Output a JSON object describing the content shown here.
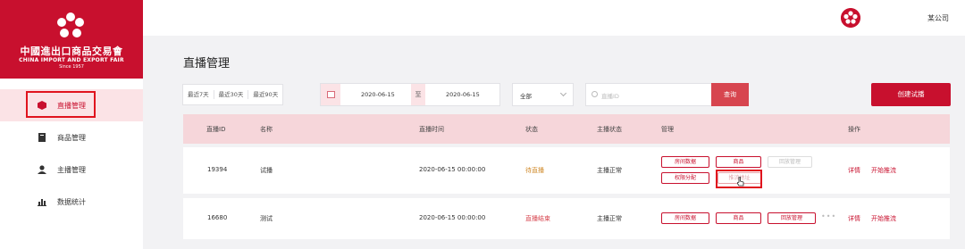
{
  "brand": {
    "logo_cn": "中國進出口商品交易會",
    "logo_en": "CHINA IMPORT AND EXPORT FAIR",
    "logo_since": "Since 1957",
    "accent": "#c8102e"
  },
  "topbar": {
    "company": "某公司"
  },
  "sidebar": {
    "items": [
      {
        "label": "直播管理",
        "icon": "cube-icon",
        "active": true
      },
      {
        "label": "商品管理",
        "icon": "book-icon",
        "active": false
      },
      {
        "label": "主播管理",
        "icon": "person-icon",
        "active": false
      },
      {
        "label": "数据统计",
        "icon": "bar-chart-icon",
        "active": false
      }
    ]
  },
  "page": {
    "title": "直播管理"
  },
  "filters": {
    "ranges": [
      "最近7天",
      "最近30天",
      "最近90天"
    ],
    "date_start": "2020-06-15",
    "date_sep": "至",
    "date_end": "2020-06-15",
    "select_value": "全部",
    "search_placeholder": "直播ID",
    "search_label": "查询",
    "create_label": "创建试播"
  },
  "table": {
    "headers": [
      "直播ID",
      "名称",
      "直播时间",
      "状态",
      "主播状态",
      "管理",
      "操作"
    ],
    "rows": [
      {
        "id": "19394",
        "name": "试播",
        "time": "2020-06-15 00:00:00",
        "status": "待直播",
        "anchor_status": "主播正常",
        "manage": [
          "房间数据",
          "商品",
          "回放管理",
          "权限分配",
          "推流地址"
        ],
        "ops": [
          "详情",
          "开始推流"
        ]
      },
      {
        "id": "16680",
        "name": "测试",
        "time": "2020-06-15 00:00:00",
        "status": "直播结束",
        "anchor_status": "主播正常",
        "manage": [
          "房间数据",
          "商品",
          "回放管理"
        ],
        "more": "•••",
        "ops": [
          "详情",
          "开始推流"
        ]
      }
    ]
  }
}
